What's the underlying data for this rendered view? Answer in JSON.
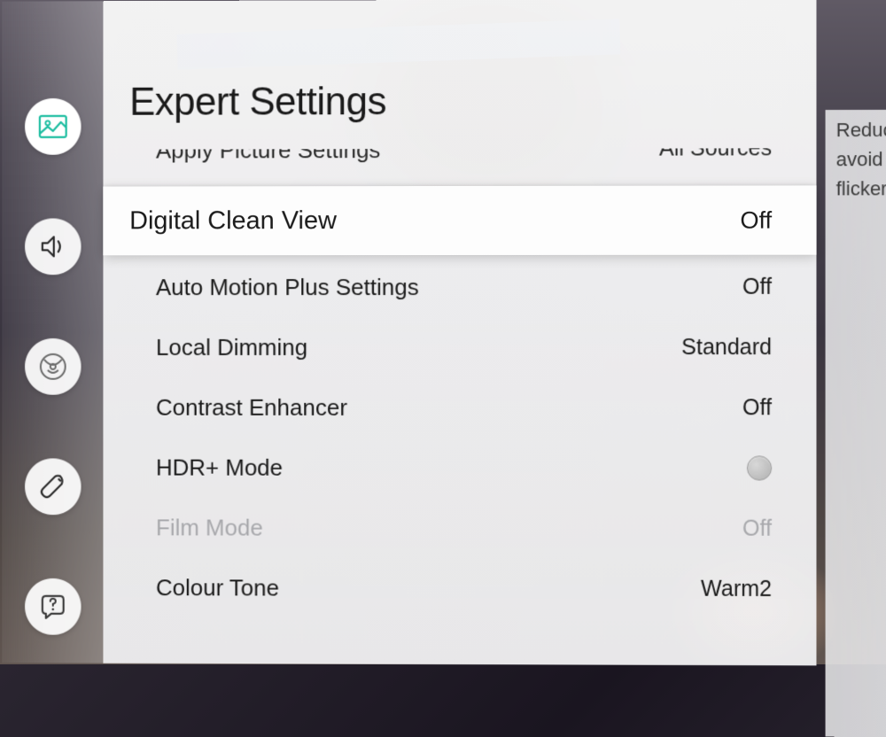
{
  "panel": {
    "title": "Expert Settings"
  },
  "sidebar": {
    "items": [
      {
        "name": "picture-icon",
        "active": true
      },
      {
        "name": "sound-icon",
        "active": false
      },
      {
        "name": "broadcast-icon",
        "active": false
      },
      {
        "name": "general-icon",
        "active": false
      },
      {
        "name": "support-icon",
        "active": false
      }
    ]
  },
  "settings": [
    {
      "label": "Apply Picture Settings",
      "value": "All Sources",
      "state": "partial-top"
    },
    {
      "label": "Digital Clean View",
      "value": "Off",
      "state": "selected"
    },
    {
      "label": "Auto Motion Plus Settings",
      "value": "Off",
      "state": "normal"
    },
    {
      "label": "Local Dimming",
      "value": "Standard",
      "state": "normal"
    },
    {
      "label": "Contrast Enhancer",
      "value": "Off",
      "state": "normal"
    },
    {
      "label": "HDR+ Mode",
      "value": "",
      "state": "toggle"
    },
    {
      "label": "Film Mode",
      "value": "Off",
      "state": "disabled"
    },
    {
      "label": "Colour Tone",
      "value": "Warm2",
      "state": "normal"
    }
  ],
  "help": {
    "line1": "Reduce",
    "line2": "avoid o",
    "line3": "flickeri"
  },
  "colors": {
    "accent": "#1bbda0",
    "text": "#1a1a1a",
    "disabled": "#a8a8ac"
  }
}
